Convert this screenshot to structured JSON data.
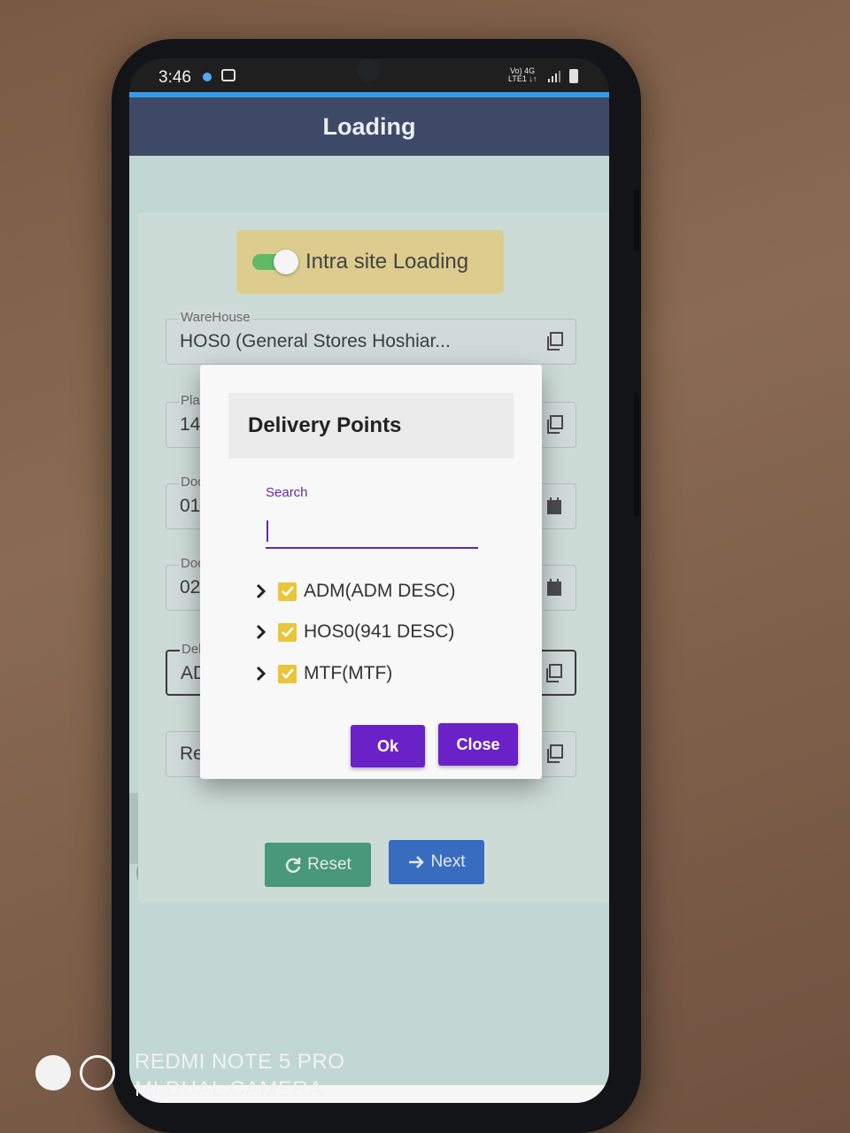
{
  "status_bar": {
    "time": "3:46",
    "network": "Vo) 4G\nLTE1"
  },
  "app": {
    "title": "Loading",
    "intra_site": {
      "label": "Intra site Loading",
      "enabled": true
    },
    "fields": [
      {
        "label": "WareHouse",
        "value": "HOS0 (General Stores Hoshiar..."
      },
      {
        "label": "Pla",
        "value": "14"
      },
      {
        "label": "Doc",
        "value": "01"
      },
      {
        "label": "Doc",
        "value": "02"
      },
      {
        "label": "Del",
        "value": "AD"
      },
      {
        "label": "",
        "value": "Re"
      }
    ],
    "reset_label": "Reset",
    "next_label": "Next"
  },
  "dialog": {
    "title": "Delivery Points",
    "search_label": "Search",
    "search_value": "",
    "items": [
      {
        "label": "ADM(ADM DESC)",
        "checked": true
      },
      {
        "label": "HOS0(941 DESC)",
        "checked": true
      },
      {
        "label": "MTF(MTF)",
        "checked": true
      }
    ],
    "ok_label": "Ok",
    "close_label": "Close"
  },
  "watermark": {
    "line1": "REDMI NOTE 5 PRO",
    "line2": "MI DUAL CAMERA"
  },
  "colors": {
    "appbar": "#243052",
    "accent": "#1a8fe6",
    "dialog_button": "#6a22c8",
    "checkbox": "#e8c53a",
    "reset": "#2f8a67",
    "next": "#1d58b7"
  }
}
